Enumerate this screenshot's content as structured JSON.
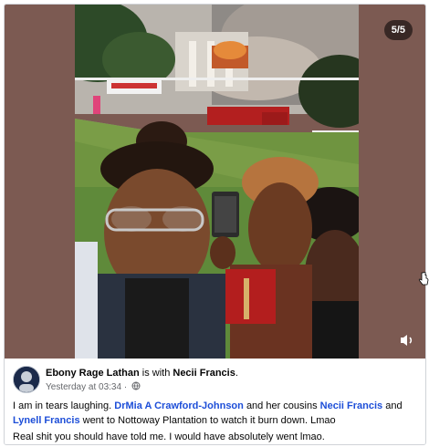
{
  "media": {
    "counter": "5/5",
    "volume_icon": "volume-icon"
  },
  "post": {
    "author": "Ebony Rage Lathan",
    "with_text": "is with",
    "tagged": "Necii Francis",
    "tagged_suffix": ".",
    "timestamp": "Yesterday at 03:34",
    "separator": "·",
    "audience_icon": "globe-icon",
    "caption": {
      "p1": "I am in tears laughing.",
      "l1": "DrMia A Crawford-Johnson",
      "p2": "and her cousins",
      "l2": "Necii Francis",
      "p3": "and",
      "l3": "Lynell Francis",
      "p4": "went to Nottoway Plantation to watch it burn down. Lmao"
    },
    "comment": "Real shit you should have told me. I would have absolutely went lmao."
  },
  "colors": {
    "frame_background": "#7c5a52",
    "link": "#1d4ed8",
    "secondary_text": "#65676b"
  }
}
